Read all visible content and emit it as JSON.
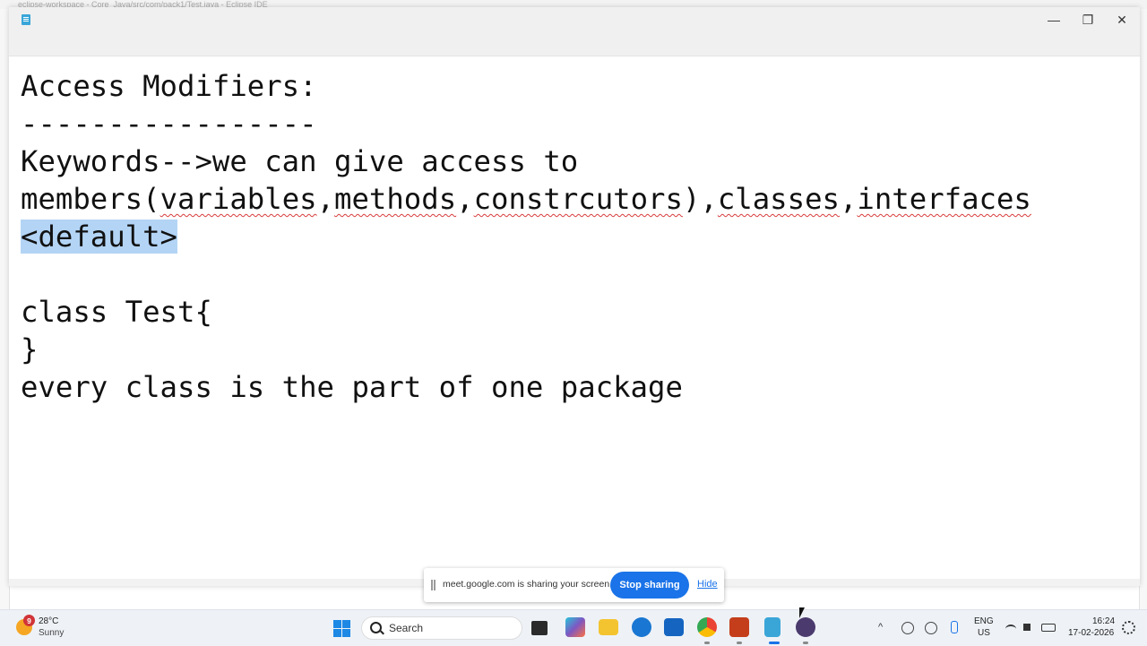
{
  "background_ide": {
    "title": "eclipse-workspace - Core_Java/src/com/pack1/Test.java - Eclipse IDE"
  },
  "notepad": {
    "window_controls": {
      "minimize": "—",
      "maximize": "❐",
      "close": "✕"
    },
    "lines": {
      "l1": "Access Modifiers:",
      "l2": "-----------------",
      "l3": "Keywords-->we can give access to",
      "l4_members": "members",
      "l4_p1": "(",
      "l4_variables": "variables",
      "l4_c1": ",",
      "l4_methods": "methods",
      "l4_c2": ",",
      "l4_constr": "constrcutors",
      "l4_p2": "),",
      "l4_classes": "classes",
      "l4_c3": ",",
      "l4_interfaces": "interfaces",
      "l5": "<default>",
      "l7": "class Test{",
      "l8": "}",
      "l9": "every class is the part of one package"
    }
  },
  "share_bar": {
    "message": "meet.google.com is sharing your screen.",
    "stop_label": "Stop sharing",
    "hide_label": "Hide",
    "accent": "#1a73e8"
  },
  "taskbar": {
    "weather": {
      "badge": "9",
      "temp": "28°C",
      "condition": "Sunny"
    },
    "search_label": "Search",
    "apps": [
      "file-manager-icon",
      "copilot-icon",
      "file-explorer-icon",
      "edge-icon",
      "store-icon",
      "chrome-icon",
      "powerpoint-icon",
      "notepad-icon",
      "eclipse-icon"
    ],
    "tray": {
      "lang": "ENG",
      "region": "US",
      "time": "16:24",
      "date": "17-02-2026"
    }
  }
}
